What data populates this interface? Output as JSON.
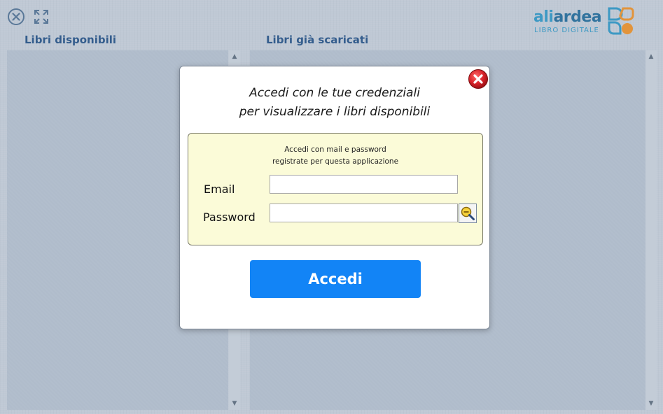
{
  "toolbar": {
    "close_icon": "circle-x-icon",
    "expand_icon": "expand-icon"
  },
  "logo": {
    "word_ali": "ali",
    "word_ardea": "ardea",
    "subtitle": "LIBRO DIGITALE",
    "colors": {
      "primary": "#2a98c8",
      "dark": "#1c6a9a",
      "orange": "#f39222"
    }
  },
  "panels": {
    "left_title": "Libri disponibili",
    "right_title": "Libri già scaricati"
  },
  "dialog": {
    "heading_line1": "Accedi con le tue credenziali",
    "heading_line2": "per visualizzare i libri disponibili",
    "hint_line1": "Accedi con mail e password",
    "hint_line2": "registrate per questa applicazione",
    "email_label": "Email",
    "email_value": "",
    "password_label": "Password",
    "password_value": "",
    "submit_label": "Accedi",
    "close_icon": "red-close-icon",
    "reveal_icon": "magnifier-icon"
  },
  "colors": {
    "background": "#c9d2dd",
    "title_blue": "#1f4f86",
    "button_blue": "#1284f6",
    "login_box": "#fbfbd8",
    "close_red": "#d8232a"
  }
}
